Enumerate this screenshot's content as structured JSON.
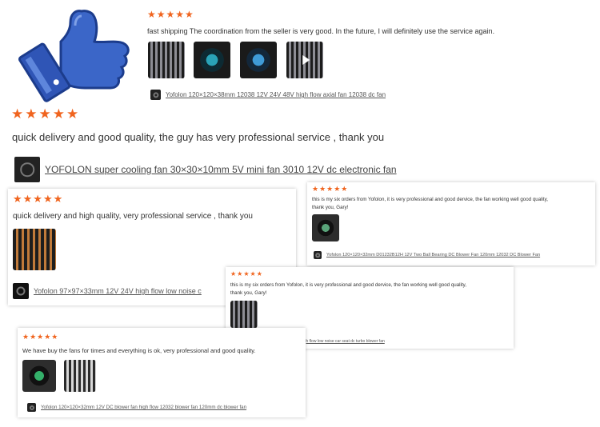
{
  "stars": "★★★★★",
  "reviews": [
    {
      "text": "fast shipping The coordination from the seller is very good. In the future, I will definitely use the service again.",
      "product": "Yofolon 120×120×38mm 12038 12V 24V 48V high flow axial fan 12038 dc fan"
    },
    {
      "text": "quick delivery and good quality, the guy has very professional service , thank you",
      "product": "YOFOLON super cooling fan 30×30×10mm 5V mini fan 3010 12V dc electronic fan"
    },
    {
      "text": "quick delivery and high quality, very professional service , thank you",
      "product": "Yofolon 97×97×33mm 12V 24V high flow low noise c"
    },
    {
      "text_line1": "this is my six orders from Yofolon, it is very professional and good dervice, the fan working well good quality,",
      "text_line2": "thank you, Gary!",
      "product": "Yofolon 120×120×32mm D01232B12H 12V Two Ball Bearing DC Blower Fan 120mm 12032 DC Blower Fan"
    },
    {
      "text_line1": "this is my six orders from Yofolon, it is very professional and good dervice, the fan working well good quality,",
      "text_line2": "thank you, Gary!",
      "product": "Yofolon 97×97×33mm 12V 24V high flow low noise car seat dc turbo blower fan"
    },
    {
      "text": "We have buy the fans for times and everything is ok, very professional and good quality.",
      "product": "Yofolon 120×120×32mm 12V DC blower fan high flow 12032 blower fan 120mm dc blower fan"
    }
  ],
  "colors": {
    "star": "#f0641e",
    "thumb_blue": "#2f55b6"
  },
  "icons": {
    "thumbs_up": "thumbs-up-icon",
    "play": "play-icon"
  }
}
